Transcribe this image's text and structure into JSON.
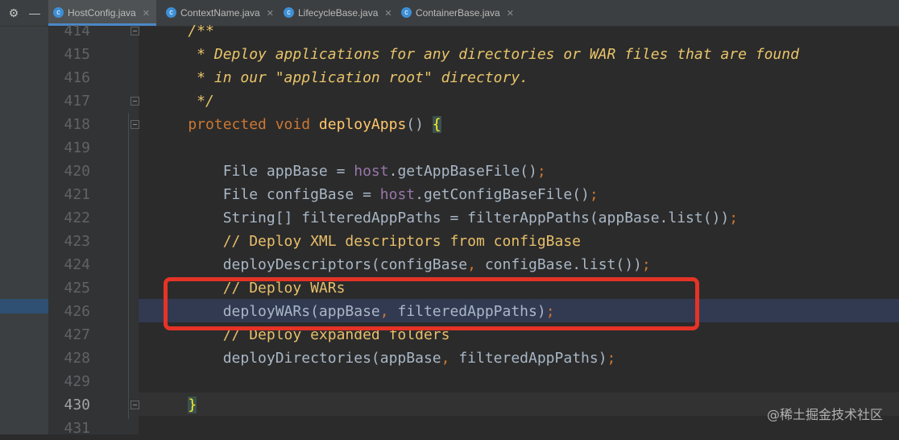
{
  "toolbar": {
    "settings_icon": "gear-icon",
    "collapse_icon": "minus-icon"
  },
  "tabs": [
    {
      "label": "HostConfig.java",
      "active": true
    },
    {
      "label": "ContextName.java",
      "active": false
    },
    {
      "label": "LifecycleBase.java",
      "active": false
    },
    {
      "label": "ContainerBase.java",
      "active": false
    }
  ],
  "editor": {
    "current_line": "430",
    "selected_line": "426",
    "lines": [
      {
        "num": "414",
        "parts": [
          {
            "t": "    /**",
            "c": "docy"
          }
        ]
      },
      {
        "num": "415",
        "parts": [
          {
            "t": "     * Deploy applications for any directories or WAR files that are found",
            "c": "docy"
          }
        ]
      },
      {
        "num": "416",
        "parts": [
          {
            "t": "     * in our \"application root\" directory.",
            "c": "docy"
          }
        ]
      },
      {
        "num": "417",
        "parts": [
          {
            "t": "     */",
            "c": "docy"
          }
        ]
      },
      {
        "num": "418",
        "parts": [
          {
            "t": "    protected void ",
            "c": "kw"
          },
          {
            "t": "deployApps",
            "c": "fn"
          },
          {
            "t": "() ",
            "c": ""
          },
          {
            "t": "{",
            "c": "brace"
          }
        ]
      },
      {
        "num": "419",
        "parts": [
          {
            "t": "",
            "c": ""
          }
        ]
      },
      {
        "num": "420",
        "parts": [
          {
            "t": "        File appBase = ",
            "c": ""
          },
          {
            "t": "host",
            "c": "fld"
          },
          {
            "t": ".getAppBaseFile()",
            "c": ""
          },
          {
            "t": ";",
            "c": "kw"
          }
        ]
      },
      {
        "num": "421",
        "parts": [
          {
            "t": "        File configBase = ",
            "c": ""
          },
          {
            "t": "host",
            "c": "fld"
          },
          {
            "t": ".getConfigBaseFile()",
            "c": ""
          },
          {
            "t": ";",
            "c": "kw"
          }
        ]
      },
      {
        "num": "422",
        "parts": [
          {
            "t": "        String[] filteredAppPaths = filterAppPaths(appBase.list())",
            "c": ""
          },
          {
            "t": ";",
            "c": "kw"
          }
        ]
      },
      {
        "num": "423",
        "parts": [
          {
            "t": "        // Deploy XML descriptors from configBase",
            "c": "lcy"
          }
        ]
      },
      {
        "num": "424",
        "parts": [
          {
            "t": "        deployDescriptors(configBase",
            "c": ""
          },
          {
            "t": ", ",
            "c": "kw"
          },
          {
            "t": "configBase.list())",
            "c": ""
          },
          {
            "t": ";",
            "c": "kw"
          }
        ]
      },
      {
        "num": "425",
        "parts": [
          {
            "t": "        // Deploy WARs",
            "c": "lcy"
          }
        ]
      },
      {
        "num": "426",
        "parts": [
          {
            "t": "        deployWARs(appBase",
            "c": ""
          },
          {
            "t": ", ",
            "c": "kw"
          },
          {
            "t": "filteredAppPaths)",
            "c": ""
          },
          {
            "t": ";",
            "c": "kw"
          }
        ]
      },
      {
        "num": "427",
        "parts": [
          {
            "t": "        // Deploy expanded folders",
            "c": "lcy"
          }
        ]
      },
      {
        "num": "428",
        "parts": [
          {
            "t": "        deployDirectories(appBase",
            "c": ""
          },
          {
            "t": ", ",
            "c": "kw"
          },
          {
            "t": "filteredAppPaths)",
            "c": ""
          },
          {
            "t": ";",
            "c": "kw"
          }
        ]
      },
      {
        "num": "429",
        "parts": [
          {
            "t": "",
            "c": ""
          }
        ]
      },
      {
        "num": "430",
        "parts": [
          {
            "t": "    ",
            "c": ""
          },
          {
            "t": "}",
            "c": "brace"
          }
        ]
      },
      {
        "num": "431",
        "parts": [
          {
            "t": "",
            "c": ""
          }
        ]
      }
    ]
  },
  "watermark": "@稀土掘金技术社区"
}
